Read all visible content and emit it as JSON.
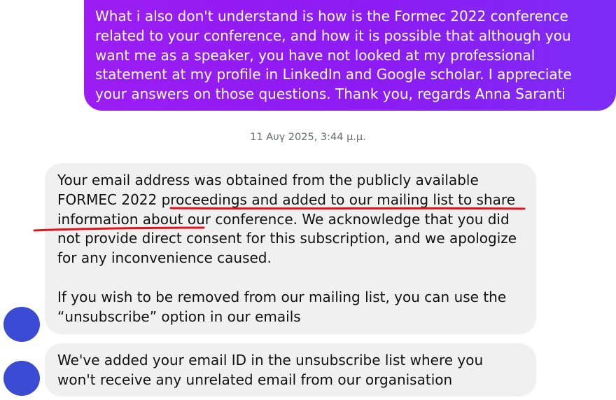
{
  "thread": {
    "outgoing_message": "What i also don't understand is how is the Formec 2022 conference related to your conference, and how it is possible that although you want me as a speaker, you have not looked at my professional statement at my profile in LinkedIn and Google scholar. I appreciate your answers on those questions. Thank you, regards Anna Saranti",
    "timestamp": "11 Αυγ 2025, 3:44 μ.μ.",
    "incoming_message_1": {
      "paragraph_1": "Your email address was obtained from the publicly available FORMEC 2022 proceedings and added to our mailing list to share information about our conference. We acknowledge that you did not provide direct consent for this subscription, and we apologize for any inconvenience caused.",
      "paragraph_2": "If you wish to be removed from our mailing list, you can use the “unsubscribe” option in our emails"
    },
    "incoming_message_2": "We've added your email ID in the unsubscribe list where you won't receive any unrelated email from our organisation"
  },
  "colors": {
    "outgoing_bubble": "#8c1cf3",
    "incoming_bubble": "#f0f0f0",
    "avatar": "#3c4bd4",
    "annotation_underline": "#e0141e"
  }
}
